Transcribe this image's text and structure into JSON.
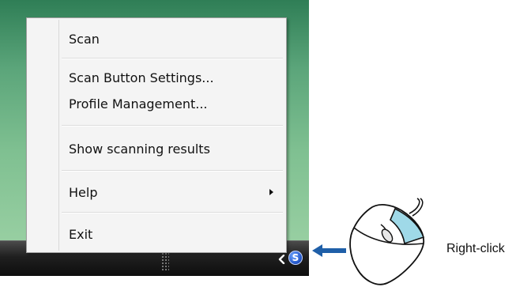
{
  "context_menu": {
    "items": [
      {
        "label": "Scan"
      },
      {
        "label": "Scan Button Settings..."
      },
      {
        "label": "Profile Management..."
      },
      {
        "label": "Show scanning results"
      },
      {
        "label": "Help",
        "has_submenu": true
      },
      {
        "label": "Exit"
      }
    ]
  },
  "taskbar": {
    "tray_icon": "scan-tray-icon",
    "tray_icon_glyph": "S",
    "show_hidden_icons": "chevron-left-icon"
  },
  "annotation": {
    "label": "Right-click",
    "arrow_icon": "arrow-left-icon",
    "mouse_icon": "mouse-right-click-icon",
    "arrow_color": "#1f5fa8",
    "mouse_button_highlight": "#9fd9e8"
  }
}
